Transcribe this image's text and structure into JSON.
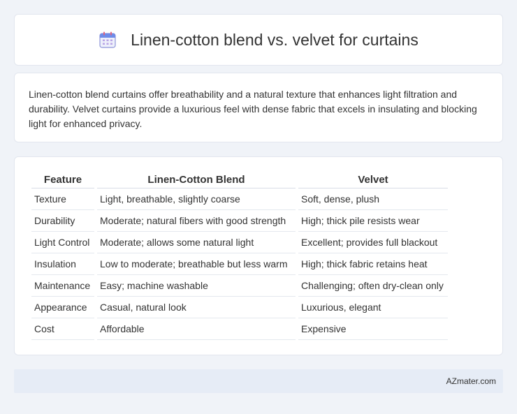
{
  "header": {
    "icon": "calendar-icon",
    "title": "Linen-cotton blend vs. velvet for curtains"
  },
  "description": "Linen-cotton blend curtains offer breathability and a natural texture that enhances light filtration and durability. Velvet curtains provide a luxurious feel with dense fabric that excels in insulating and blocking light for enhanced privacy.",
  "table": {
    "headers": [
      "Feature",
      "Linen-Cotton Blend",
      "Velvet"
    ],
    "rows": [
      [
        "Texture",
        "Light, breathable, slightly coarse",
        "Soft, dense, plush"
      ],
      [
        "Durability",
        "Moderate; natural fibers with good strength",
        "High; thick pile resists wear"
      ],
      [
        "Light Control",
        "Moderate; allows some natural light",
        "Excellent; provides full blackout"
      ],
      [
        "Insulation",
        "Low to moderate; breathable but less warm",
        "High; thick fabric retains heat"
      ],
      [
        "Maintenance",
        "Easy; machine washable",
        "Challenging; often dry-clean only"
      ],
      [
        "Appearance",
        "Casual, natural look",
        "Luxurious, elegant"
      ],
      [
        "Cost",
        "Affordable",
        "Expensive"
      ]
    ]
  },
  "footer": {
    "source": "AZmater.com"
  }
}
